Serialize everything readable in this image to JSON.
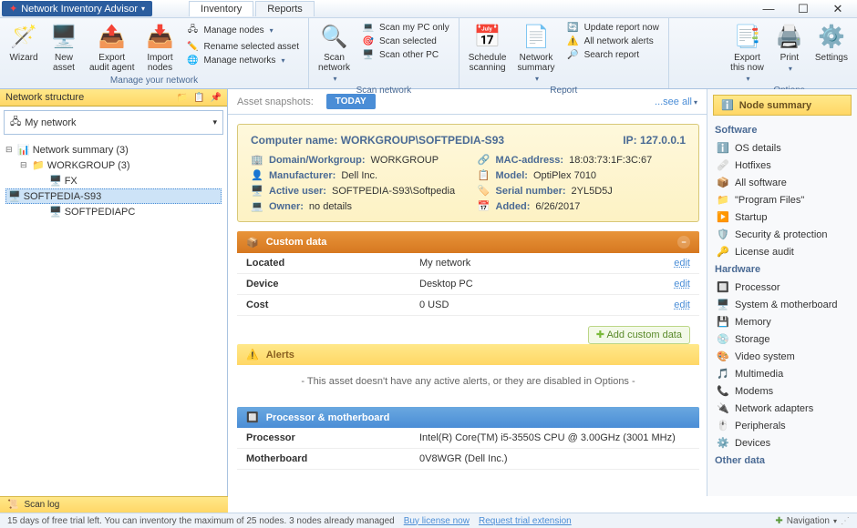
{
  "app": {
    "title": "Network Inventory Advisor"
  },
  "tabs": [
    {
      "label": "Inventory",
      "active": true
    },
    {
      "label": "Reports",
      "active": false
    }
  ],
  "ribbon": {
    "group1": {
      "label": "Manage your network",
      "big": [
        {
          "label": "Wizard"
        },
        {
          "label": "New\nasset"
        },
        {
          "label": "Export\naudit agent"
        },
        {
          "label": "Import\nnodes"
        }
      ],
      "list": [
        "Manage nodes",
        "Rename selected asset",
        "Manage networks"
      ]
    },
    "group2": {
      "label": "Scan network",
      "big": [
        {
          "label": "Scan\nnetwork"
        }
      ],
      "list": [
        "Scan my PC only",
        "Scan selected",
        "Scan other PC"
      ]
    },
    "group3": {
      "label": "Report",
      "big": [
        {
          "label": "Schedule\nscanning"
        },
        {
          "label": "Network\nsummary"
        }
      ],
      "list": [
        "Update report now",
        "All network alerts",
        "Search report"
      ]
    },
    "group4": {
      "label": "Options",
      "big": [
        {
          "label": "Export\nthis now"
        },
        {
          "label": "Print"
        },
        {
          "label": "Settings"
        }
      ]
    }
  },
  "netstruct": {
    "header": "Network structure",
    "combo": "My network"
  },
  "tree": {
    "root": "Network summary (3)",
    "wg": "WORKGROUP (3)",
    "nodes": [
      "FX",
      "SOFTPEDIA-S93",
      "SOFTPEDIAPC"
    ]
  },
  "snapshot": {
    "label": "Asset snapshots:",
    "today": "TODAY",
    "seeall": "...see all"
  },
  "card": {
    "title_key": "Computer name:",
    "title_val": "WORKGROUP\\SOFTPEDIA-S93",
    "ip_key": "IP:",
    "ip_val": "127.0.0.1",
    "rows": [
      {
        "k": "Domain/Workgroup:",
        "v": "WORKGROUP"
      },
      {
        "k": "MAC-address:",
        "v": "18:03:73:1F:3C:67"
      },
      {
        "k": "Manufacturer:",
        "v": "Dell Inc."
      },
      {
        "k": "Model:",
        "v": "OptiPlex 7010"
      },
      {
        "k": "Active user:",
        "v": "SOFTPEDIA-S93\\Softpedia"
      },
      {
        "k": "Serial number:",
        "v": "2YL5D5J"
      },
      {
        "k": "Owner:",
        "v": "no details"
      },
      {
        "k": "Added:",
        "v": "6/26/2017"
      }
    ]
  },
  "custom": {
    "header": "Custom data",
    "rows": [
      {
        "k": "Located",
        "v": "My network"
      },
      {
        "k": "Device",
        "v": "Desktop PC"
      },
      {
        "k": "Cost",
        "v": "0 USD"
      }
    ],
    "edit": "edit",
    "add": "Add custom data"
  },
  "alerts": {
    "header": "Alerts",
    "msg": "- This asset doesn't have any active alerts, or they are disabled in Options -"
  },
  "pm": {
    "header": "Processor & motherboard",
    "rows": [
      {
        "k": "Processor",
        "v": "Intel(R) Core(TM) i5-3550S CPU @ 3.00GHz (3001 MHz)"
      },
      {
        "k": "Motherboard",
        "v": "0V8WGR (Dell Inc.)"
      }
    ]
  },
  "rside": {
    "title": "Node summary",
    "software": {
      "h": "Software",
      "items": [
        "OS details",
        "Hotfixes",
        "All software",
        "\"Program Files\"",
        "Startup",
        "Security & protection",
        "License audit"
      ]
    },
    "hardware": {
      "h": "Hardware",
      "items": [
        "Processor",
        "System & motherboard",
        "Memory",
        "Storage",
        "Video system",
        "Multimedia",
        "Modems",
        "Network adapters",
        "Peripherals",
        "Devices"
      ]
    },
    "other": {
      "h": "Other data"
    }
  },
  "scanlog": "Scan log",
  "status": {
    "msg": "15 days of free trial left. You can inventory the maximum of 25 nodes. 3 nodes already managed",
    "buy": "Buy license now",
    "req": "Request trial extension",
    "nav": "Navigation"
  }
}
